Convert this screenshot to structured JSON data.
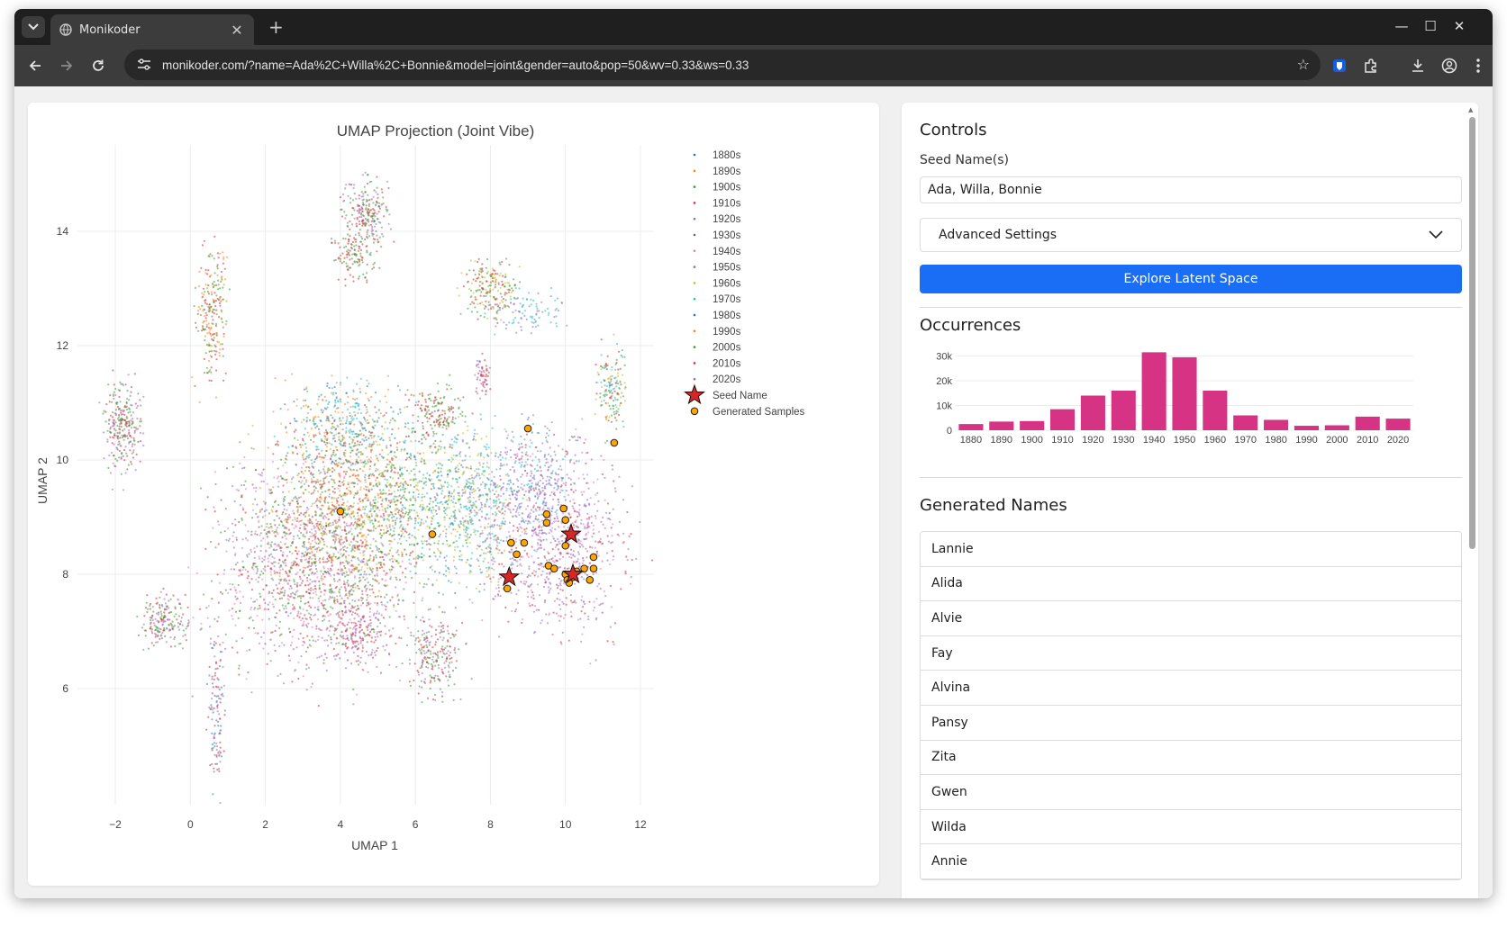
{
  "browser": {
    "tab_title": "Monikoder",
    "url": "monikoder.com/?name=Ada%2C+Willa%2C+Bonnie&model=joint&gender=auto&pop=50&wv=0.33&ws=0.33"
  },
  "umap_chart": {
    "title": "UMAP Projection (Joint Vibe)",
    "xlabel": "UMAP 1",
    "ylabel": "UMAP 2",
    "xticks": [
      "−2",
      "0",
      "2",
      "4",
      "6",
      "8",
      "10",
      "12"
    ],
    "yticks": [
      "6",
      "8",
      "10",
      "12",
      "14"
    ],
    "legend": [
      {
        "label": "1880s",
        "color": "#1f77b4"
      },
      {
        "label": "1890s",
        "color": "#ff7f0e"
      },
      {
        "label": "1900s",
        "color": "#2ca02c"
      },
      {
        "label": "1910s",
        "color": "#d62728"
      },
      {
        "label": "1920s",
        "color": "#9467bd"
      },
      {
        "label": "1930s",
        "color": "#8c564b"
      },
      {
        "label": "1940s",
        "color": "#e377c2"
      },
      {
        "label": "1950s",
        "color": "#7f7f7f"
      },
      {
        "label": "1960s",
        "color": "#bcbd22"
      },
      {
        "label": "1970s",
        "color": "#17becf"
      },
      {
        "label": "1980s",
        "color": "#1f77b4"
      },
      {
        "label": "1990s",
        "color": "#ff7f0e"
      },
      {
        "label": "2000s",
        "color": "#2ca02c"
      },
      {
        "label": "2010s",
        "color": "#d62728"
      },
      {
        "label": "2020s",
        "color": "#9467bd"
      },
      {
        "label": "Seed Name",
        "color": "#d62728"
      },
      {
        "label": "Generated Samples",
        "color": "#ffa500"
      }
    ]
  },
  "chart_data": [
    {
      "type": "scatter",
      "title": "UMAP Projection (Joint Vibe)",
      "xlabel": "UMAP 1",
      "ylabel": "UMAP 2",
      "xlim": [
        -3,
        13
      ],
      "ylim": [
        4.5,
        15.5
      ],
      "series": [
        {
          "name": "Seed Name",
          "x": [
            10.15,
            8.5,
            10.2
          ],
          "y": [
            8.7,
            7.95,
            8.0
          ]
        },
        {
          "name": "Generated Samples",
          "x": [
            9.0,
            11.3,
            4.0,
            6.45,
            9.5,
            9.5,
            9.95,
            10.0,
            8.55,
            8.9,
            8.7,
            10.0,
            9.55,
            9.7,
            10.75,
            10.5,
            10.75,
            10.0,
            10.2,
            10.3,
            10.05,
            10.65,
            10.1,
            8.45
          ],
          "y": [
            10.55,
            10.3,
            9.1,
            8.7,
            9.05,
            8.9,
            9.15,
            8.95,
            8.55,
            8.55,
            8.35,
            8.5,
            8.15,
            8.1,
            8.3,
            8.1,
            8.1,
            8.0,
            7.95,
            8.05,
            7.9,
            7.9,
            7.85,
            7.75
          ]
        }
      ]
    },
    {
      "type": "bar",
      "title": "Occurrences",
      "categories": [
        "1880",
        "1890",
        "1900",
        "1910",
        "1920",
        "1930",
        "1940",
        "1950",
        "1960",
        "1970",
        "1980",
        "1990",
        "2000",
        "2010",
        "2020"
      ],
      "values": [
        2500,
        3500,
        3700,
        8500,
        14000,
        16000,
        31500,
        29500,
        16000,
        6000,
        4200,
        1800,
        2000,
        5500,
        4700
      ],
      "yticks": [
        "0",
        "10k",
        "20k",
        "30k"
      ],
      "ylim": [
        0,
        32000
      ]
    }
  ],
  "controls": {
    "heading": "Controls",
    "seed_label": "Seed Name(s)",
    "seed_value": "Ada, Willa, Bonnie",
    "advanced_label": "Advanced Settings",
    "explore_label": "Explore Latent Space"
  },
  "occurrences": {
    "heading": "Occurrences",
    "bar_color": "#d63384"
  },
  "generated": {
    "heading": "Generated Names",
    "names": [
      "Lannie",
      "Alida",
      "Alvie",
      "Fay",
      "Alvina",
      "Pansy",
      "Zita",
      "Gwen",
      "Wilda",
      "Annie"
    ]
  }
}
